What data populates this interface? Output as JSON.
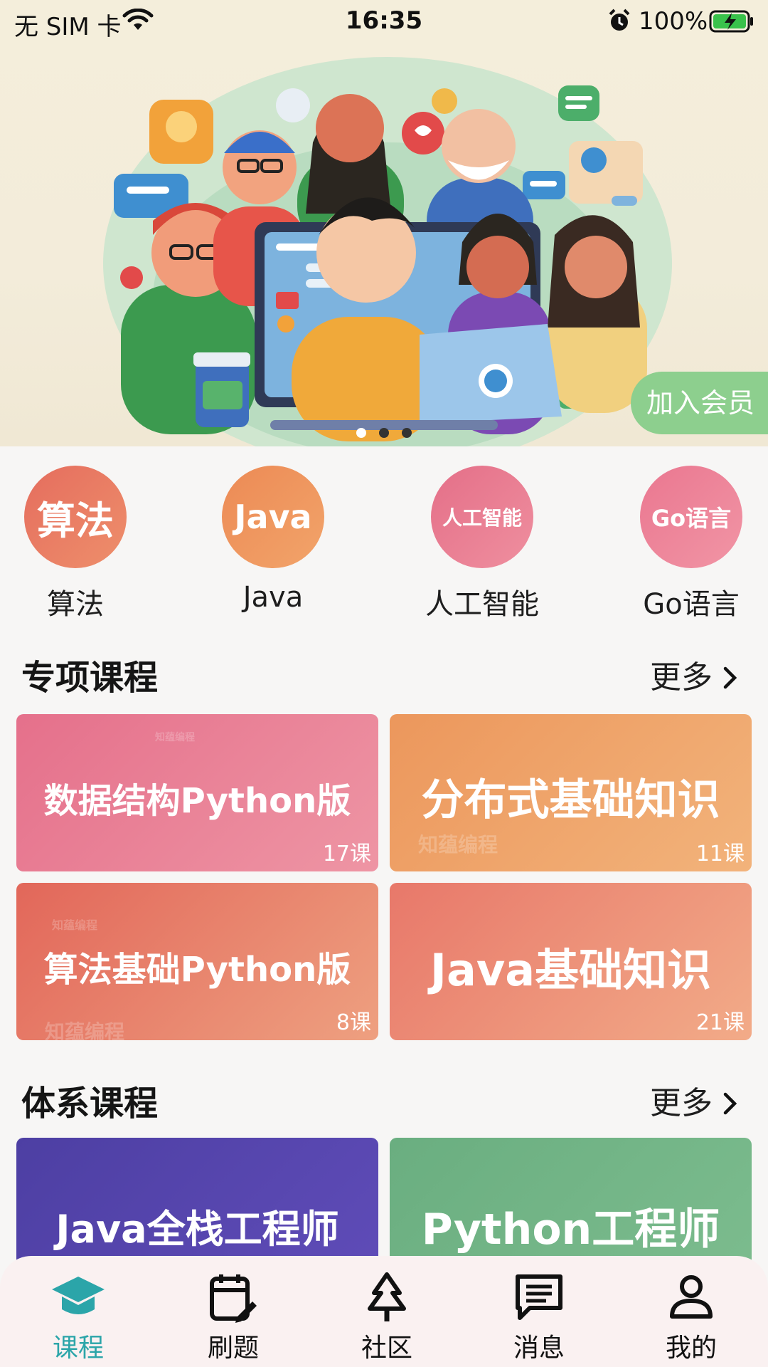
{
  "status_bar": {
    "carrier": "无 SIM 卡",
    "time": "16:35",
    "battery": "100%"
  },
  "banner": {
    "join_label": "加入会员",
    "page_count": 3,
    "active_page": 0
  },
  "categories": [
    {
      "icon_text": "算法",
      "label": "算法",
      "color_from": "#e56d5e",
      "color_to": "#ee8f6b"
    },
    {
      "icon_text": "Java",
      "label": "Java",
      "color_from": "#ec8a55",
      "color_to": "#f2a46a"
    },
    {
      "icon_text": "人工智能",
      "label": "人工智能",
      "color_from": "#e46f88",
      "color_to": "#ef8f9f"
    },
    {
      "icon_text": "Go语言",
      "label": "Go语言",
      "color_from": "#ea7790",
      "color_to": "#f195a5"
    }
  ],
  "special_courses": {
    "title": "专项课程",
    "more": "更多",
    "items": [
      {
        "title": "数据结构Python版",
        "count": "17课",
        "color_from": "#e5708b",
        "color_to": "#ee95a4"
      },
      {
        "title": "分布式基础知识",
        "count": "11课",
        "color_from": "#ec975c",
        "color_to": "#f2b37b"
      },
      {
        "title": "算法基础Python版",
        "count": "8课",
        "color_from": "#e2675a",
        "color_to": "#eea080"
      },
      {
        "title": "Java基础知识",
        "count": "21课",
        "color_from": "#e8786a",
        "color_to": "#f2ab88"
      }
    ],
    "watermark": "知蕴编程"
  },
  "system_courses": {
    "title": "体系课程",
    "more": "更多",
    "items": [
      {
        "title": "Java全栈工程师",
        "color_from": "#4d3fa3",
        "color_to": "#5f4cb8"
      },
      {
        "title": "Python工程师",
        "color_from": "#6aae80",
        "color_to": "#7cbc8e"
      }
    ]
  },
  "tabs": [
    {
      "label": "课程",
      "icon": "graduation-cap-icon",
      "active": true
    },
    {
      "label": "刷题",
      "icon": "calendar-edit-icon",
      "active": false
    },
    {
      "label": "社区",
      "icon": "tree-icon",
      "active": false
    },
    {
      "label": "消息",
      "icon": "message-icon",
      "active": false
    },
    {
      "label": "我的",
      "icon": "user-icon",
      "active": false
    }
  ],
  "colors": {
    "accent": "#2ba5a9",
    "join_button": "#8dcf8e",
    "tabbar_bg": "#faf1f1"
  }
}
